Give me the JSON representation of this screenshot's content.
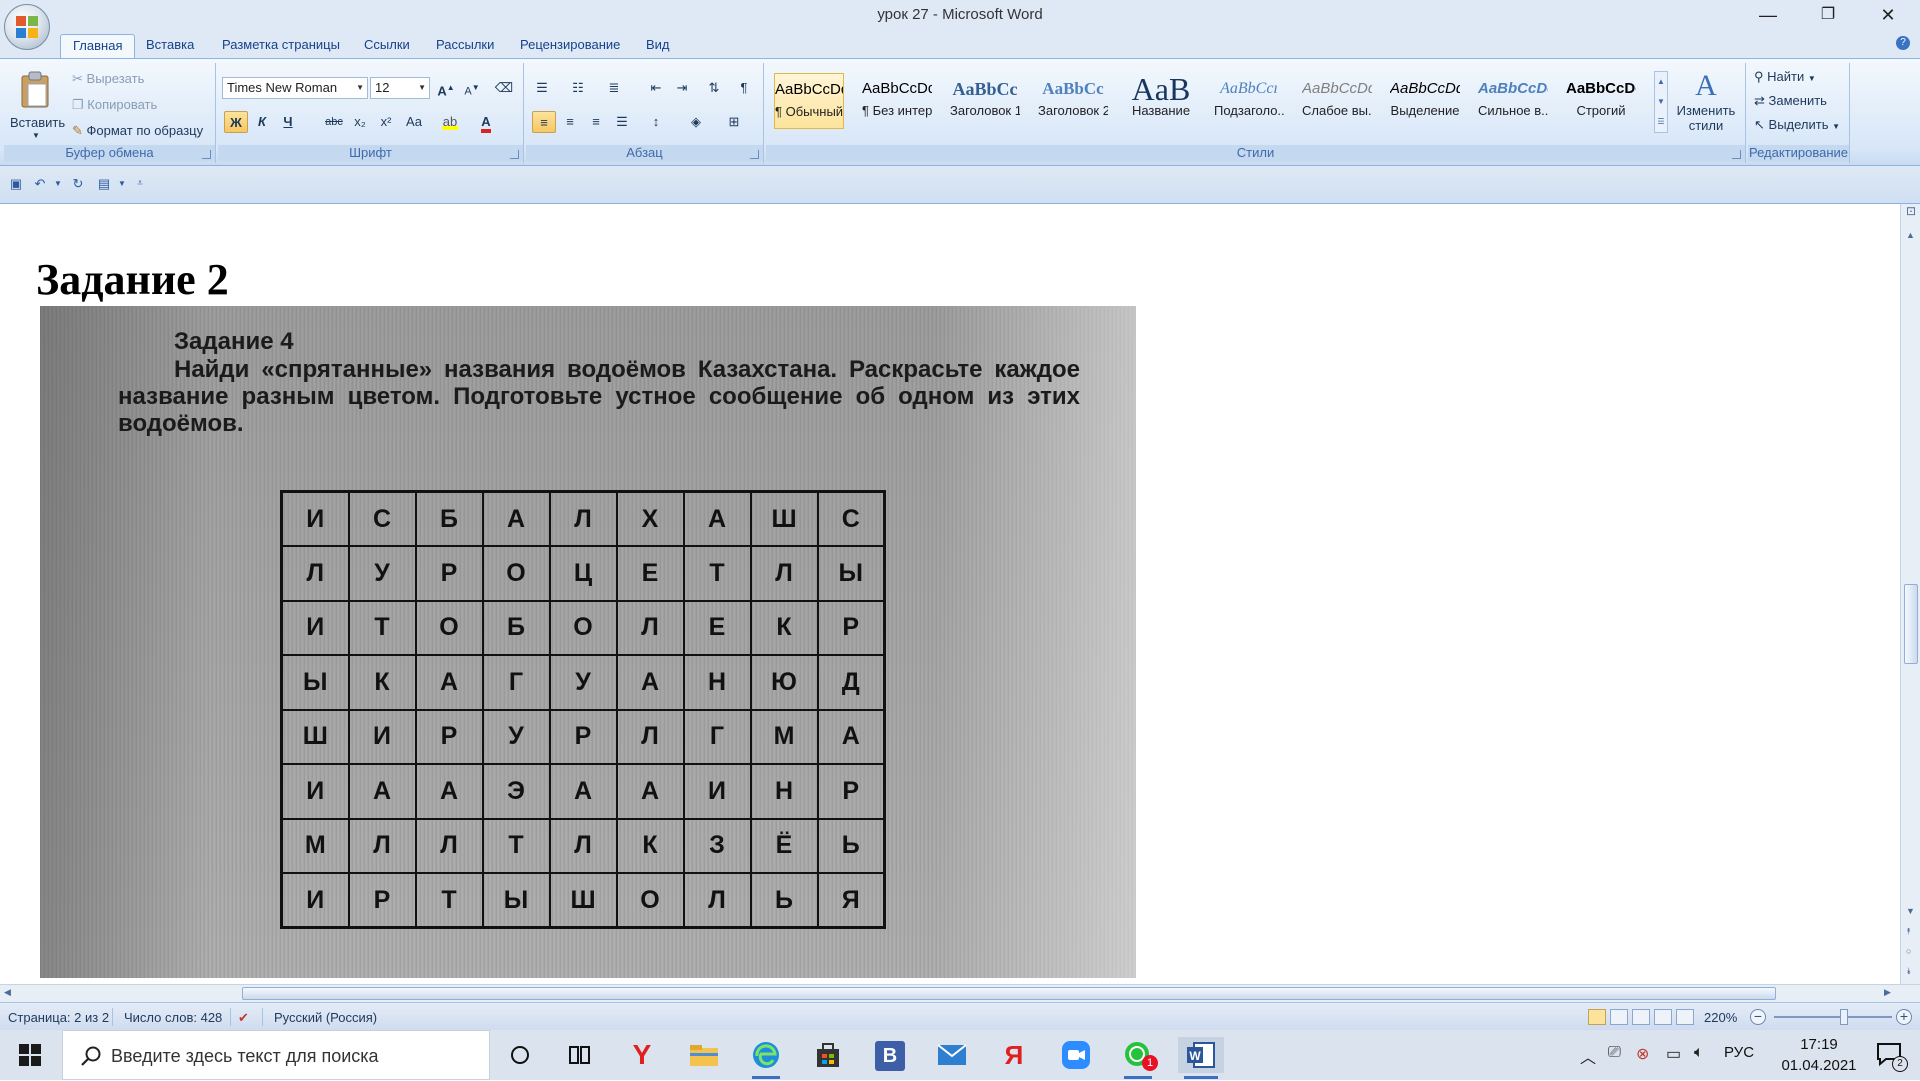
{
  "window": {
    "title": "урок 27 - Microsoft Word",
    "controls": {
      "minimize": "—",
      "restore": "❐",
      "close": "✕"
    }
  },
  "tabs": [
    "Главная",
    "Вставка",
    "Разметка страницы",
    "Ссылки",
    "Рассылки",
    "Рецензирование",
    "Вид"
  ],
  "active_tab": "Главная",
  "ribbon": {
    "clipboard": {
      "label": "Буфер обмена",
      "paste": "Вставить",
      "cut": "Вырезать",
      "copy": "Копировать",
      "format_painter": "Формат по образцу"
    },
    "font": {
      "label": "Шрифт",
      "family": "Times New Roman",
      "size": "12",
      "grow": "A",
      "shrink": "A",
      "bold": "Ж",
      "italic": "К",
      "underline": "Ч",
      "strike": "abc",
      "subscript": "x₂",
      "superscript": "x²",
      "change_case": "Aa",
      "font_color": "A"
    },
    "paragraph": {
      "label": "Абзац",
      "pilcrow": "¶"
    },
    "styles": {
      "label": "Стили",
      "items": [
        {
          "sample": "AaBbCcDd",
          "name": "¶ Обычный"
        },
        {
          "sample": "AaBbCcDd",
          "name": "¶ Без интер..."
        },
        {
          "sample": "AaBbCc",
          "name": "Заголовок 1"
        },
        {
          "sample": "AaBbCc",
          "name": "Заголовок 2"
        },
        {
          "sample": "AaB",
          "name": "Название"
        },
        {
          "sample": "AaBbCcı",
          "name": "Подзаголо..."
        },
        {
          "sample": "AaBbCcDd",
          "name": "Слабое вы..."
        },
        {
          "sample": "AaBbCcDd",
          "name": "Выделение"
        },
        {
          "sample": "AaBbCcDd",
          "name": "Сильное в..."
        },
        {
          "sample": "AaBbCcDc",
          "name": "Строгий"
        }
      ],
      "change_styles": "Изменить стили"
    },
    "editing": {
      "label": "Редактирование",
      "find": "Найти",
      "replace": "Заменить",
      "select": "Выделить"
    }
  },
  "document": {
    "heading": "Задание 2",
    "image": {
      "task_title": "Задание 4",
      "task_text": "Найди «спрятанные» названия водоёмов Казахстана. Раскрасьте каждое название разным цветом. Подготовьте устное сообщение об одном из этих водоёмов.",
      "grid": [
        [
          "И",
          "С",
          "Б",
          "А",
          "Л",
          "Х",
          "А",
          "Ш",
          "С"
        ],
        [
          "Л",
          "У",
          "Р",
          "О",
          "Ц",
          "Е",
          "Т",
          "Л",
          "Ы"
        ],
        [
          "И",
          "Т",
          "О",
          "Б",
          "О",
          "Л",
          "Е",
          "К",
          "Р"
        ],
        [
          "Ы",
          "К",
          "А",
          "Г",
          "У",
          "А",
          "Н",
          "Ю",
          "Д"
        ],
        [
          "Ш",
          "И",
          "Р",
          "У",
          "Р",
          "Л",
          "Г",
          "М",
          "А"
        ],
        [
          "И",
          "А",
          "А",
          "Э",
          "А",
          "А",
          "И",
          "Н",
          "Р"
        ],
        [
          "М",
          "Л",
          "Л",
          "Т",
          "Л",
          "К",
          "З",
          "Ё",
          "Ь"
        ],
        [
          "И",
          "Р",
          "Т",
          "Ы",
          "Ш",
          "О",
          "Л",
          "Ь",
          "Я"
        ]
      ]
    }
  },
  "statusbar": {
    "page": "Страница: 2 из 2",
    "words": "Число слов: 428",
    "language": "Русский (Россия)",
    "zoom": "220%",
    "zoom_minus": "−",
    "zoom_plus": "+"
  },
  "taskbar": {
    "search_placeholder": "Введите здесь текст для поиска",
    "icons": [
      "cortana-circle-icon",
      "task-view-icon",
      "yandex-browser-icon",
      "file-explorer-icon",
      "edge-icon",
      "store-icon",
      "b-app-icon",
      "mail-icon",
      "yandex-icon",
      "zoom-icon",
      "whatsapp-icon",
      "word-icon"
    ],
    "badge": "1",
    "b_letter": "B",
    "lang": "РУС",
    "time": "17:19",
    "date": "01.04.2021",
    "notif_count": "2"
  },
  "colors": {
    "ribbon_bg": "#d7e6f8",
    "accent": "#15428b",
    "taskbar_bg": "#dbe3ee",
    "word_blue": "#2b579a"
  }
}
